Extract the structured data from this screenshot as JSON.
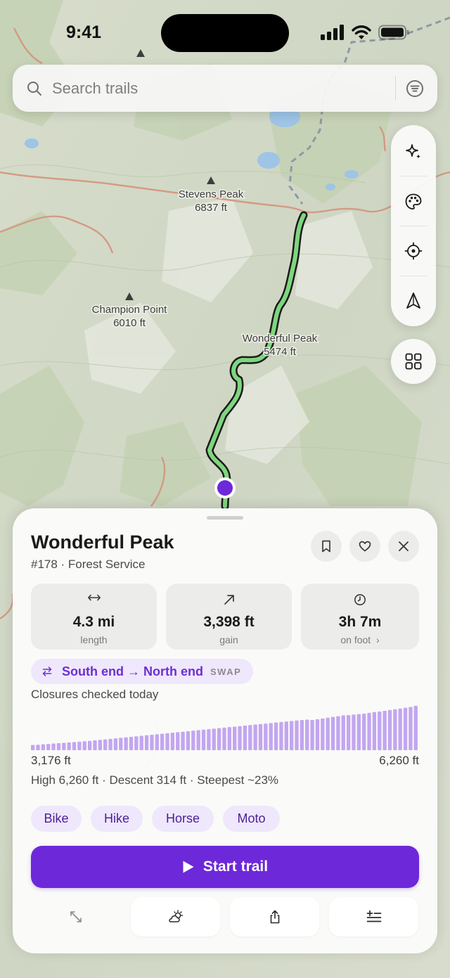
{
  "status_bar": {
    "time": "9:41"
  },
  "search": {
    "placeholder": "Search trails"
  },
  "map": {
    "peaks": [
      {
        "name": "Stevens Peak",
        "elevation": "6837 ft"
      },
      {
        "name": "Champion Point",
        "elevation": "6010 ft"
      },
      {
        "name": "Wonderful Peak",
        "elevation": "5474 ft"
      }
    ],
    "route_color": "#7ed67e",
    "position_marker_color": "#6d28d9"
  },
  "map_controls": [
    "sparkles-icon",
    "palette-icon",
    "locate-icon",
    "compass-icon",
    "layers-grid-icon"
  ],
  "trail": {
    "name": "Wonderful Peak",
    "subtitle": "#178 · Forest Service",
    "stats": [
      {
        "icon": "length-arrows-icon",
        "value": "4.3 mi",
        "label": "length"
      },
      {
        "icon": "gain-arrow-icon",
        "value": "3,398 ft",
        "label": "gain"
      },
      {
        "icon": "clock-icon",
        "value": "3h 7m",
        "label": "on foot  ›"
      }
    ],
    "direction": {
      "text": "South end → North end",
      "swap": "SWAP"
    },
    "closures": "Closures checked today",
    "elevation": {
      "min_label": "3,176 ft",
      "max_label": "6,260 ft",
      "summary": "High 6,260 ft · Descent 314 ft · Steepest ~23%"
    },
    "activities": [
      "Bike",
      "Hike",
      "Horse",
      "Moto"
    ],
    "start_label": "Start trail"
  },
  "accent_color": "#6d28d9",
  "chart_data": {
    "type": "bar",
    "title": "",
    "xlabel": "",
    "ylabel": "",
    "ylim": [
      3100,
      6300
    ],
    "values": [
      3176,
      3200,
      3230,
      3260,
      3290,
      3320,
      3350,
      3380,
      3410,
      3440,
      3470,
      3500,
      3540,
      3580,
      3620,
      3660,
      3700,
      3740,
      3780,
      3820,
      3860,
      3900,
      3940,
      3980,
      4020,
      4060,
      4100,
      4140,
      4180,
      4220,
      4260,
      4300,
      4340,
      4380,
      4420,
      4460,
      4500,
      4540,
      4580,
      4620,
      4660,
      4700,
      4740,
      4780,
      4820,
      4860,
      4900,
      4940,
      4980,
      5020,
      5060,
      5100,
      5140,
      5170,
      5140,
      5200,
      5260,
      5320,
      5380,
      5440,
      5500,
      5520,
      5560,
      5600,
      5640,
      5700,
      5760,
      5800,
      5860,
      5920,
      5980,
      6040,
      6100,
      6160,
      6260
    ]
  }
}
